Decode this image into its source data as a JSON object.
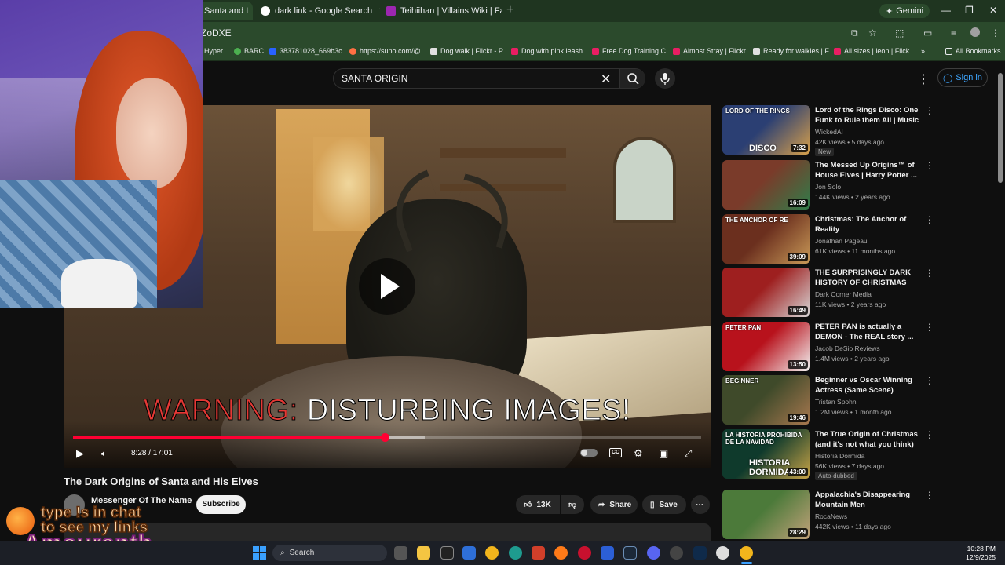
{
  "browser": {
    "tabs": [
      {
        "title": "Santa and I",
        "active": true
      },
      {
        "title": "dark link - Google Search",
        "active": false
      },
      {
        "title": "Teihiihan | Villains Wiki | Fando",
        "active": false
      }
    ],
    "gemini_label": "Gemini",
    "omnibox_text": "ZoDXE",
    "bookmarks": [
      "Hyper...",
      "BARC",
      "383781028_669b3c...",
      "https://suno.com/@...",
      "Dog walk | Flickr - P...",
      "Dog with pink leash...",
      "Free Dog Training C...",
      "Almost Stray | Flickr...",
      "Ready for walkies | F...",
      "All sizes | leon | Flick..."
    ],
    "all_bookmarks_label": "All Bookmarks"
  },
  "youtube": {
    "search_query": "SANTA ORIGIN",
    "sign_in_label": "Sign in",
    "player": {
      "overlay_warning_red": "WARNING:",
      "overlay_warning_white": "DISTURBING IMAGES!",
      "time_display": "8:28 / 17:01",
      "played_fraction": 0.4962,
      "buffered_fraction": 0.56,
      "cc_label": "CC"
    },
    "video_title": "The Dark Origins of Santa and His Elves",
    "channel_name": "Messenger Of The Name",
    "subscribe_label": "Subscribe",
    "likes": "13K",
    "share_label": "Share",
    "save_label": "Save",
    "recommendations": [
      {
        "title": "Lord of the Rings Disco: One Funk to Rule them All | Music ...",
        "channel": "WickedAI",
        "stats": "42K views • 5 days ago",
        "duration": "7:32",
        "badge": "New",
        "thumb_text": "LORD OF THE RINGS",
        "thumb_text2": "DISCO",
        "colors": [
          "#2b3f73",
          "#d9a14b"
        ]
      },
      {
        "title": "The Messed Up Origins™ of House Elves | Harry Potter ...",
        "channel": "Jon Solo",
        "stats": "144K views • 2 years ago",
        "duration": "16:09",
        "badge": "",
        "thumb_text": "",
        "thumb_text2": "",
        "colors": [
          "#7a3b2a",
          "#2f7d4a"
        ]
      },
      {
        "title": "Christmas: The Anchor of Reality",
        "channel": "Jonathan Pageau",
        "stats": "61K views • 11 months ago",
        "duration": "39:09",
        "badge": "",
        "thumb_text": "THE ANCHOR OF RE",
        "thumb_text2": "",
        "colors": [
          "#6b2f1e",
          "#c99a58"
        ]
      },
      {
        "title": "THE SURPRISINGLY DARK HISTORY OF CHRISTMAS",
        "channel": "Dark Corner Media",
        "stats": "11K views • 2 years ago",
        "duration": "16:49",
        "badge": "",
        "thumb_text": "",
        "thumb_text2": "",
        "colors": [
          "#9e1f1f",
          "#d8d8d8"
        ]
      },
      {
        "title": "PETER PAN is actually a DEMON - The REAL story ...",
        "channel": "Jacob DeSio Reviews",
        "stats": "1.4M views • 2 years ago",
        "duration": "13:50",
        "badge": "",
        "thumb_text": "PETER PAN",
        "thumb_text2": "",
        "colors": [
          "#b8121c",
          "#f2f2f2"
        ]
      },
      {
        "title": "Beginner vs Oscar Winning Actress (Same Scene)",
        "channel": "Tristan Spohn",
        "stats": "1.2M views • 1 month ago",
        "duration": "19:46",
        "badge": "",
        "thumb_text": "BEGINNER",
        "thumb_text2": "",
        "colors": [
          "#3f4a2a",
          "#a8784f"
        ]
      },
      {
        "title": "The True Origin of Christmas (and it's not what you think)",
        "channel": "Historia Dormida",
        "stats": "56K views • 7 days ago",
        "duration": "43:00",
        "badge": "Auto-dubbed",
        "thumb_text": "LA HISTORIA PROHIBIDA DE LA NAVIDAD",
        "thumb_text2": "HISTORIA DORMIDA",
        "colors": [
          "#0f3a2c",
          "#c9a447"
        ]
      },
      {
        "title": "Appalachia's Disappearing Mountain Men",
        "channel": "RocaNews",
        "stats": "442K views • 11 days ago",
        "duration": "28:29",
        "badge": "",
        "thumb_text": "",
        "thumb_text2": "",
        "colors": [
          "#4c7a3a",
          "#c2a27a"
        ]
      }
    ]
  },
  "stream_overlay": {
    "chat_line1": "type !s in chat",
    "chat_line2": "to see my links",
    "streamer_name": "Amouranth"
  },
  "taskbar": {
    "search_placeholder": "Search",
    "time": "10:28 PM",
    "date": "12/9/2025"
  }
}
